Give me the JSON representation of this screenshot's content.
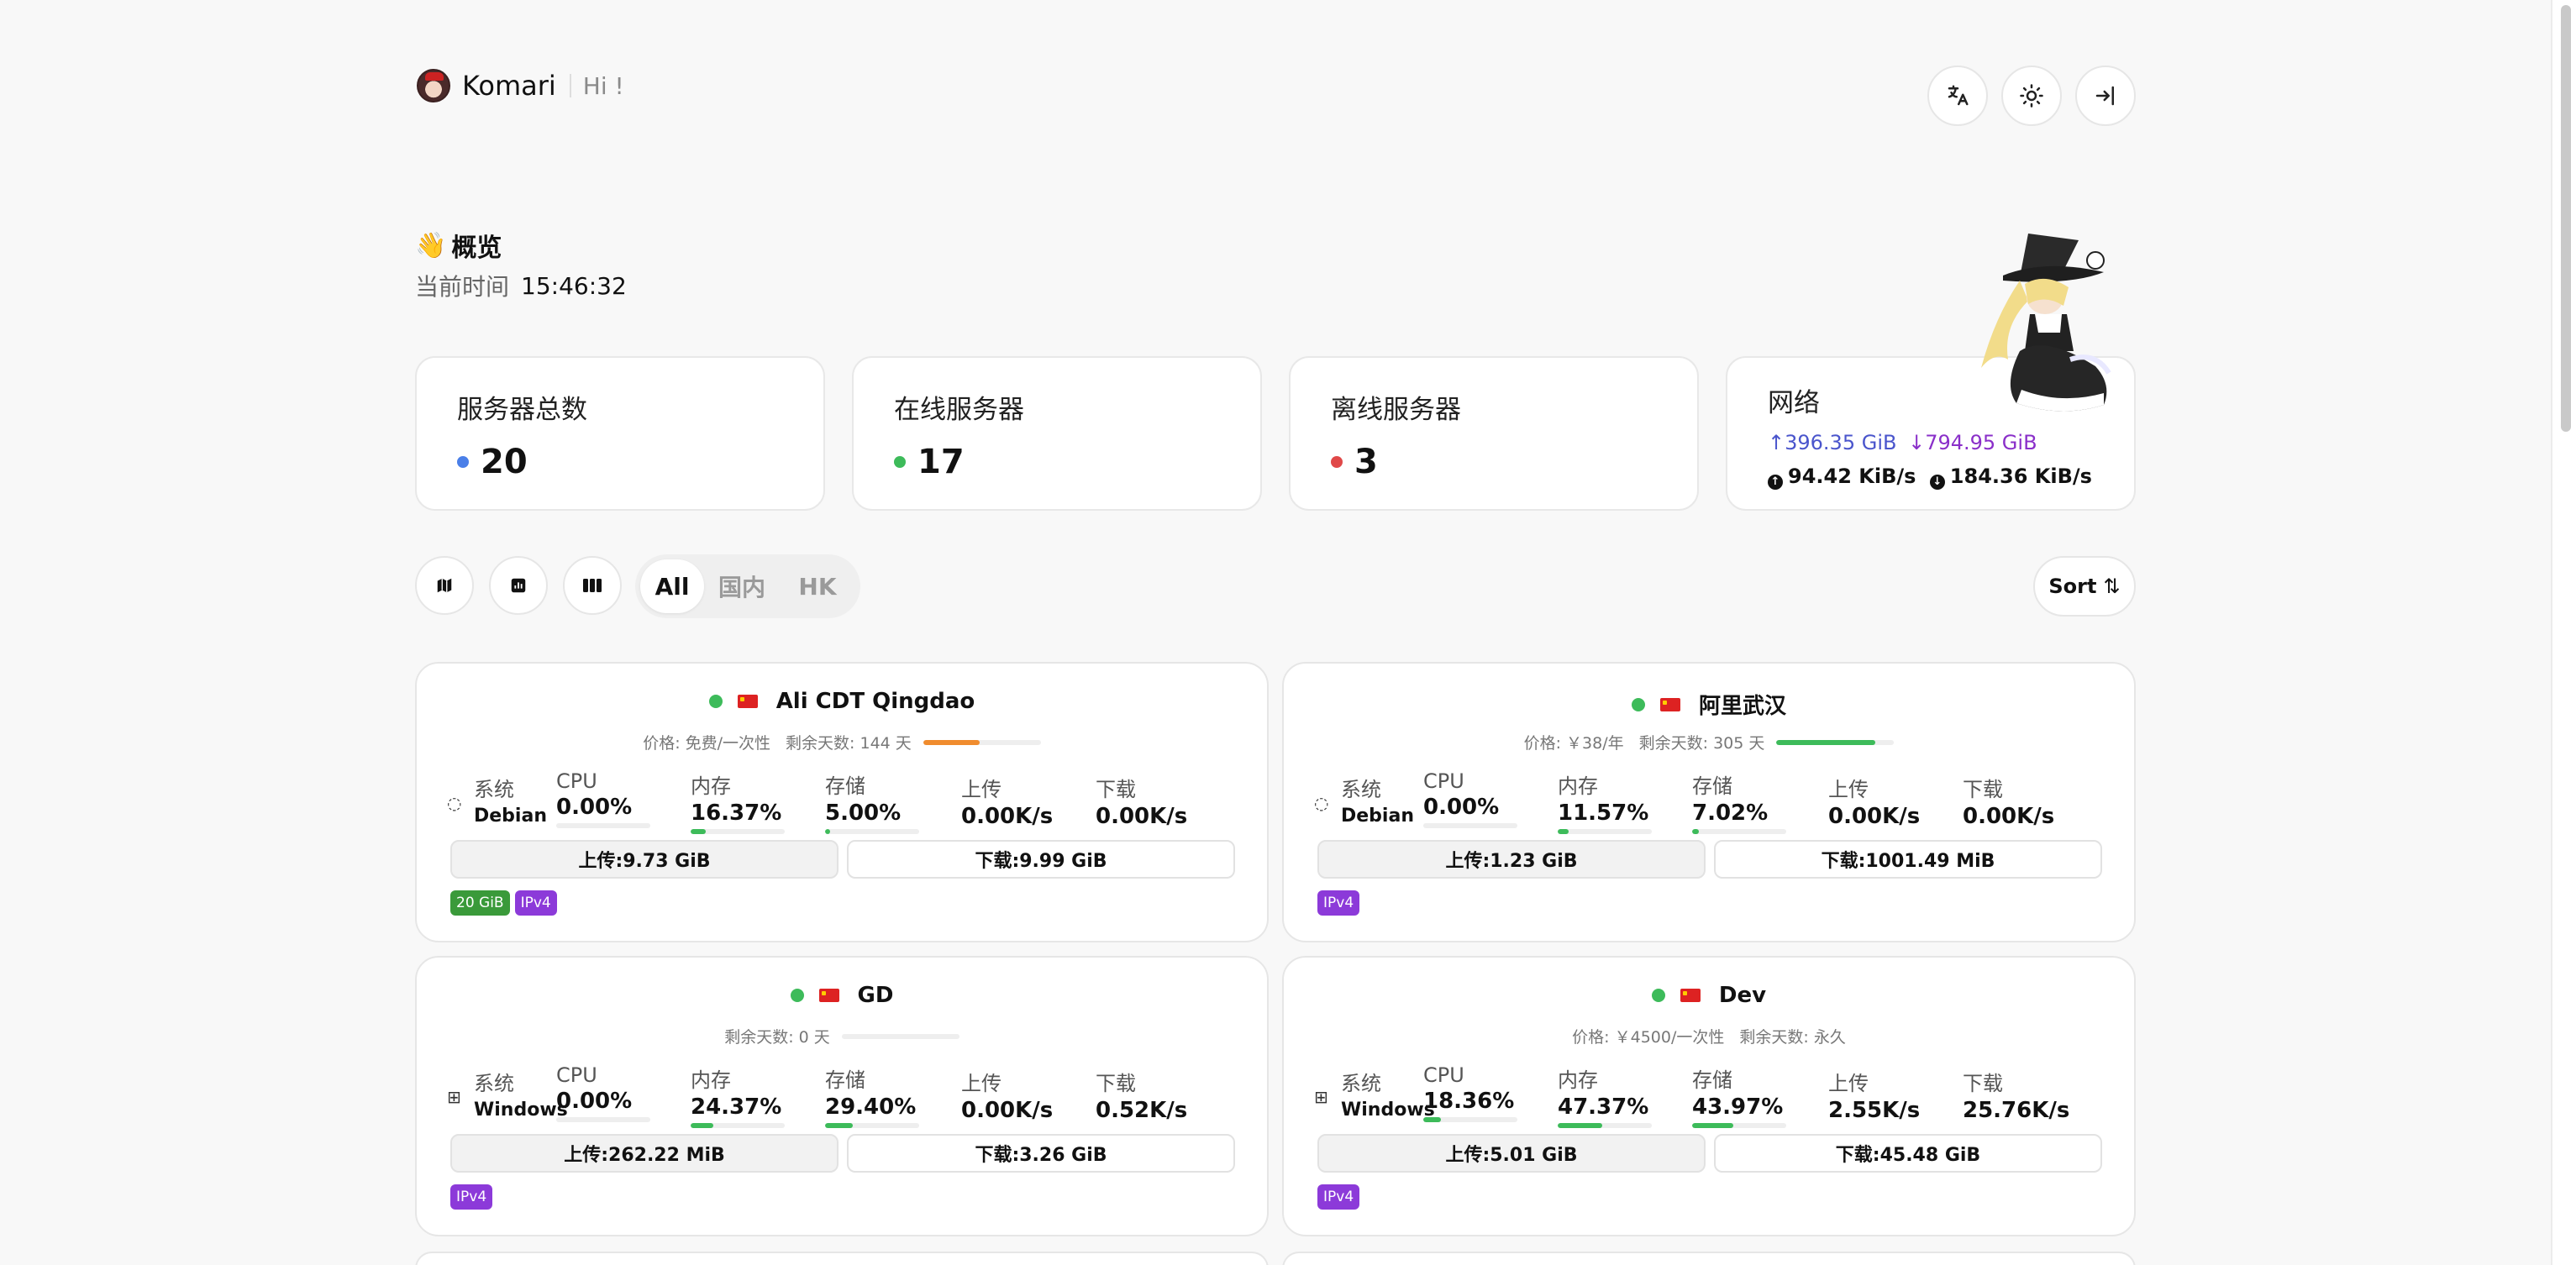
{
  "header": {
    "brand": "Komari",
    "greeting": "Hi !",
    "buttons": [
      {
        "name": "translate-icon",
        "glyph": "文A"
      },
      {
        "name": "sun-icon",
        "glyph": "☼"
      },
      {
        "name": "login-icon",
        "glyph": "⇥"
      }
    ]
  },
  "overview": {
    "wave": "👋",
    "title": "概览",
    "time_label": "当前时间",
    "time_value": "15:46:32"
  },
  "stats": {
    "total_label": "服务器总数",
    "total_value": "20",
    "online_label": "在线服务器",
    "online_value": "17",
    "offline_label": "离线服务器",
    "offline_value": "3",
    "network_label": "网络",
    "net_up_total": "↑396.35 GiB",
    "net_down_total": "↓794.95 GiB",
    "net_up_speed": "94.42 KiB/s",
    "net_down_speed": "184.36 KiB/s"
  },
  "colors": {
    "total_dot": "#4a7fe8",
    "online_dot": "#3dbb5a",
    "offline_dot": "#e04848"
  },
  "toolbar": {
    "icons": [
      "map-icon",
      "chart-icon",
      "grid-icon"
    ],
    "tabs": [
      "All",
      "国内",
      "HK"
    ],
    "active_tab": "All",
    "sort_label": "Sort",
    "sort_glyph": "⇅"
  },
  "labels": {
    "sys": "系统",
    "cpu": "CPU",
    "mem": "内存",
    "disk": "存储",
    "up": "上传",
    "down": "下载"
  },
  "servers": [
    {
      "name": "Ali CDT Qingdao",
      "price": "价格: 免费/一次性",
      "days": "剩余天数: 144 天",
      "days_fraction": 0.48,
      "days_color": "#f08c2e",
      "os": "Debian",
      "cpu": "0.00%",
      "cpu_frac": 0.0,
      "mem": "16.37%",
      "mem_frac": 0.1637,
      "disk": "5.00%",
      "disk_frac": 0.05,
      "up_speed": "0.00K/s",
      "down_speed": "0.00K/s",
      "up_total": "上传:9.73 GiB",
      "down_total": "下载:9.99 GiB",
      "tags": [
        {
          "text": "20 GiB",
          "color": "green"
        },
        {
          "text": "IPv4",
          "color": "purple"
        }
      ]
    },
    {
      "name": "阿里武汉",
      "price": "价格: ￥38/年",
      "days": "剩余天数: 305 天",
      "days_fraction": 0.84,
      "days_color": "#3dbb5a",
      "os": "Debian",
      "cpu": "0.00%",
      "cpu_frac": 0.0,
      "mem": "11.57%",
      "mem_frac": 0.1157,
      "disk": "7.02%",
      "disk_frac": 0.0702,
      "up_speed": "0.00K/s",
      "down_speed": "0.00K/s",
      "up_total": "上传:1.23 GiB",
      "down_total": "下载:1001.49 MiB",
      "tags": [
        {
          "text": "IPv4",
          "color": "purple"
        }
      ]
    },
    {
      "name": "GD",
      "price": "",
      "days": "剩余天数: 0 天",
      "days_fraction": 0.0,
      "days_color": "#3dbb5a",
      "os": "Windows",
      "cpu": "0.00%",
      "cpu_frac": 0.0,
      "mem": "24.37%",
      "mem_frac": 0.2437,
      "disk": "29.40%",
      "disk_frac": 0.294,
      "up_speed": "0.00K/s",
      "down_speed": "0.52K/s",
      "up_total": "上传:262.22 MiB",
      "down_total": "下载:3.26 GiB",
      "tags": [
        {
          "text": "IPv4",
          "color": "purple"
        }
      ]
    },
    {
      "name": "Dev",
      "price": "价格: ￥4500/一次性",
      "days": "剩余天数: 永久",
      "days_fraction": null,
      "days_color": "#3dbb5a",
      "os": "Windows",
      "cpu": "18.36%",
      "cpu_frac": 0.1836,
      "mem": "47.37%",
      "mem_frac": 0.4737,
      "disk": "43.97%",
      "disk_frac": 0.4397,
      "up_speed": "2.55K/s",
      "down_speed": "25.76K/s",
      "up_total": "上传:5.01 GiB",
      "down_total": "下载:45.48 GiB",
      "tags": [
        {
          "text": "IPv4",
          "color": "purple"
        }
      ]
    }
  ]
}
